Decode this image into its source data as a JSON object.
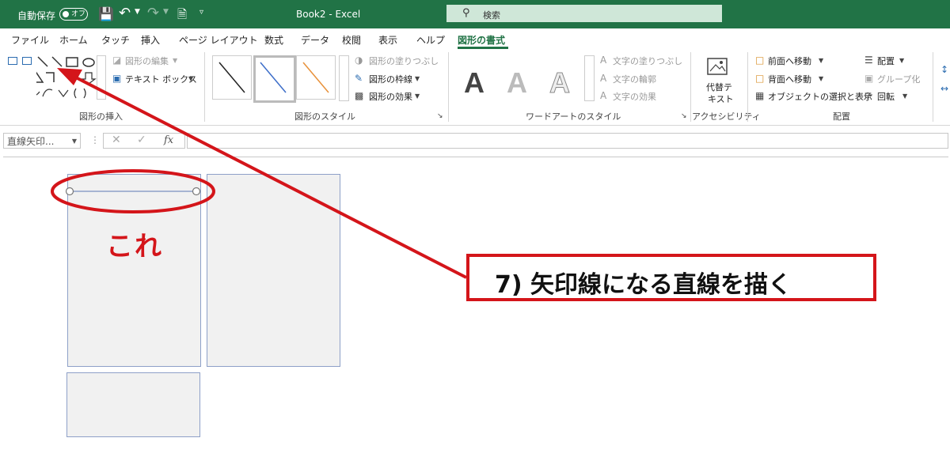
{
  "titlebar": {
    "autosave_label": "自動保存",
    "autosave_state": "オフ",
    "file_title": "Book2  -  Excel",
    "search_placeholder": "検索"
  },
  "tabs": [
    "ファイル",
    "ホーム",
    "タッチ",
    "挿入",
    "ページ レイアウト",
    "数式",
    "データ",
    "校閲",
    "表示",
    "ヘルプ",
    "図形の書式"
  ],
  "ribbon": {
    "insert_shapes": {
      "edit_shape": "図形の編集",
      "text_box": "テキスト ボックス",
      "label": "図形の挿入"
    },
    "shape_styles": {
      "fill": "図形の塗りつぶし",
      "outline": "図形の枠線",
      "effects": "図形の効果",
      "label": "図形のスタイル"
    },
    "wordart": {
      "letter": "A",
      "text_fill": "文字の塗りつぶし",
      "text_outline": "文字の輪郭",
      "text_effects": "文字の効果",
      "label": "ワードアートのスタイル"
    },
    "accessibility": {
      "alt_text_line1": "代替テ",
      "alt_text_line2": "キスト",
      "label": "アクセシビリティ"
    },
    "arrange": {
      "bring_forward": "前面へ移動",
      "send_backward": "背面へ移動",
      "selection_pane": "オブジェクトの選択と表示",
      "align": "配置",
      "group": "グループ化",
      "rotate": "回転",
      "label": "配置"
    }
  },
  "formula_bar": {
    "name_box": "直線矢印...",
    "fx": "fx"
  },
  "annotations": {
    "kore": "これ",
    "callout": "7) 矢印線になる直線を描く"
  },
  "colors": {
    "excel_green": "#217346",
    "annotation_red": "#d4151a"
  }
}
